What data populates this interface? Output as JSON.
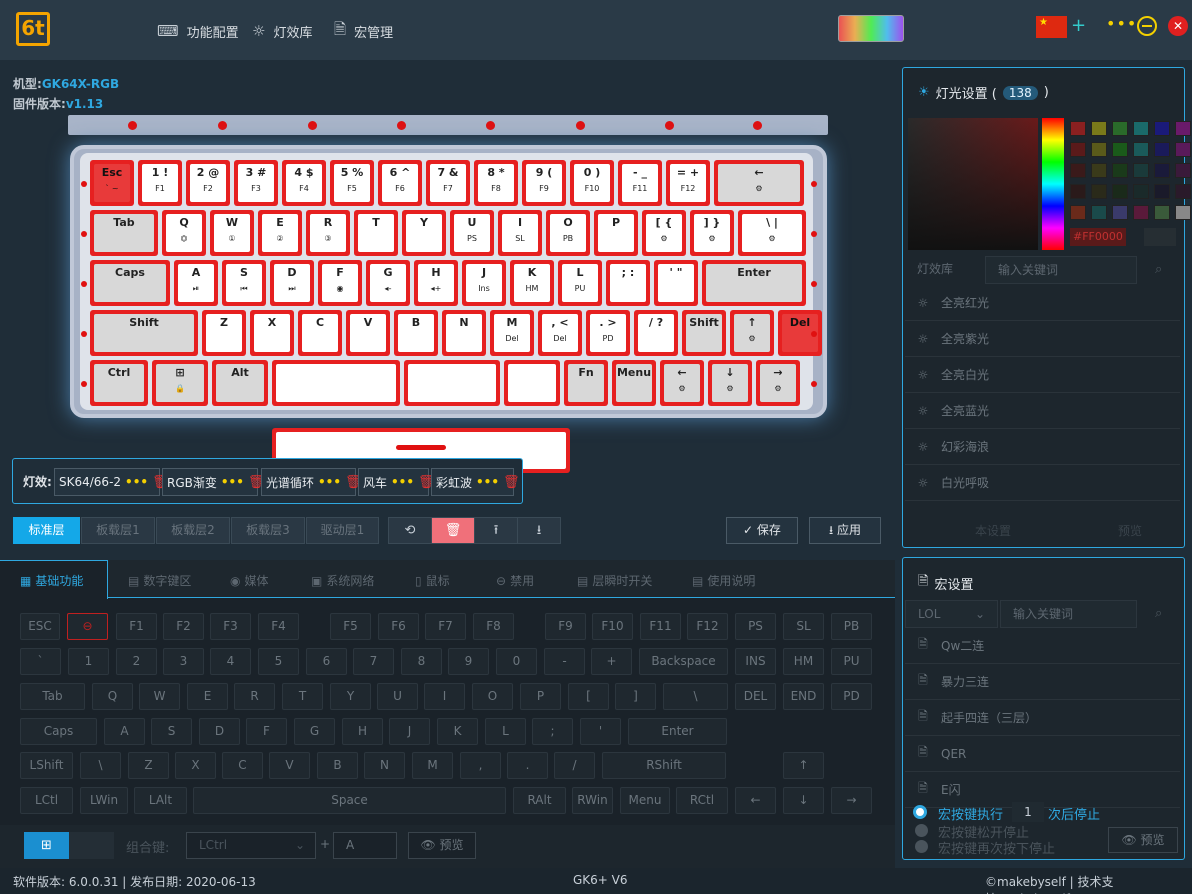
{
  "app": {
    "logo_text": "6t"
  },
  "nav": [
    {
      "label": "功能配置",
      "icon": "keyboard-icon"
    },
    {
      "label": "灯效库",
      "icon": "bulb-icon"
    },
    {
      "label": "宏管理",
      "icon": "document-icon"
    }
  ],
  "device": {
    "model_label": "机型:",
    "model": "GK64X-RGB",
    "firmware_label": "固件版本:",
    "firmware": "v1.13"
  },
  "keyboard": {
    "rows": [
      [
        {
          "t": "Esc",
          "s": "` ~",
          "style": "red"
        },
        {
          "t": "1 !",
          "s": "F1"
        },
        {
          "t": "2 @",
          "s": "F2"
        },
        {
          "t": "3 #",
          "s": "F3"
        },
        {
          "t": "4 $",
          "s": "F4"
        },
        {
          "t": "5 %",
          "s": "F5"
        },
        {
          "t": "6 ^",
          "s": "F6"
        },
        {
          "t": "7 &",
          "s": "F7"
        },
        {
          "t": "8 *",
          "s": "F8"
        },
        {
          "t": "9 (",
          "s": "F9"
        },
        {
          "t": "0 )",
          "s": "F10"
        },
        {
          "t": "- _",
          "s": "F11"
        },
        {
          "t": "= +",
          "s": "F12"
        },
        {
          "t": "←",
          "s": "⚙",
          "style": "gray"
        }
      ],
      [
        {
          "t": "Tab",
          "s": "",
          "style": "gray"
        },
        {
          "t": "Q",
          "s": "⏣"
        },
        {
          "t": "W",
          "s": "①"
        },
        {
          "t": "E",
          "s": "②"
        },
        {
          "t": "R",
          "s": "③"
        },
        {
          "t": "T",
          "s": ""
        },
        {
          "t": "Y",
          "s": ""
        },
        {
          "t": "U",
          "s": "PS"
        },
        {
          "t": "I",
          "s": "SL"
        },
        {
          "t": "O",
          "s": "PB"
        },
        {
          "t": "P",
          "s": ""
        },
        {
          "t": "[ {",
          "s": "⚙"
        },
        {
          "t": "] }",
          "s": "⚙"
        },
        {
          "t": "\\ |",
          "s": "⚙"
        }
      ],
      [
        {
          "t": "Caps",
          "s": "",
          "style": "gray"
        },
        {
          "t": "A",
          "s": "⏯"
        },
        {
          "t": "S",
          "s": "⏮"
        },
        {
          "t": "D",
          "s": "⏭"
        },
        {
          "t": "F",
          "s": "◉"
        },
        {
          "t": "G",
          "s": "◂-"
        },
        {
          "t": "H",
          "s": "◂+"
        },
        {
          "t": "J",
          "s": "Ins"
        },
        {
          "t": "K",
          "s": "HM"
        },
        {
          "t": "L",
          "s": "PU"
        },
        {
          "t": "; :",
          "s": ""
        },
        {
          "t": "' \"",
          "s": ""
        },
        {
          "t": "Enter",
          "s": "",
          "style": "gray"
        }
      ],
      [
        {
          "t": "Shift",
          "s": "",
          "style": "gray"
        },
        {
          "t": "Z",
          "s": ""
        },
        {
          "t": "X",
          "s": ""
        },
        {
          "t": "C",
          "s": ""
        },
        {
          "t": "V",
          "s": ""
        },
        {
          "t": "B",
          "s": ""
        },
        {
          "t": "N",
          "s": ""
        },
        {
          "t": "M",
          "s": "Del"
        },
        {
          "t": ", <",
          "s": "Del"
        },
        {
          "t": ". >",
          "s": "PD"
        },
        {
          "t": "/ ?",
          "s": ""
        },
        {
          "t": "Shift",
          "s": "",
          "style": "gray"
        },
        {
          "t": "↑",
          "s": "⚙",
          "style": "gray"
        },
        {
          "t": "Del",
          "s": "",
          "style": "red"
        }
      ],
      [
        {
          "t": "Ctrl",
          "s": "",
          "style": "gray"
        },
        {
          "t": "⊞",
          "s": "🔒",
          "style": "gray"
        },
        {
          "t": "Alt",
          "s": "",
          "style": "gray"
        },
        {
          "t": "",
          "s": ""
        },
        {
          "t": "",
          "s": ""
        },
        {
          "t": "",
          "s": ""
        },
        {
          "t": "Fn",
          "s": "",
          "style": "gray"
        },
        {
          "t": "Menu",
          "s": "",
          "style": "gray"
        },
        {
          "t": "←",
          "s": "⚙",
          "style": "gray"
        },
        {
          "t": "↓",
          "s": "⚙",
          "style": "gray"
        },
        {
          "t": "→",
          "s": "⚙",
          "style": "gray"
        }
      ]
    ]
  },
  "effects": {
    "label": "灯效:",
    "items": [
      "SK64/66-2",
      "RGB渐变",
      "光谱循环",
      "风车",
      "彩虹波"
    ]
  },
  "layers": [
    "标准层",
    "板载层1",
    "板载层2",
    "板载层3",
    "驱动层1"
  ],
  "tools": [
    "⟲",
    "🗑",
    "⭱",
    "⭳"
  ],
  "actions": {
    "save": "保存",
    "apply": "应用",
    "save_icon": "check-icon",
    "apply_icon": "download-icon"
  },
  "bottom_tabs": [
    {
      "label": "基础功能",
      "icon": "▦"
    },
    {
      "label": "数字键区",
      "icon": "▤"
    },
    {
      "label": "媒体",
      "icon": "◉"
    },
    {
      "label": "系统网络",
      "icon": "▣"
    },
    {
      "label": "鼠标",
      "icon": "▯"
    },
    {
      "label": "禁用",
      "icon": "⊖"
    },
    {
      "label": "层瞬时开关",
      "icon": "▤"
    },
    {
      "label": "使用说明",
      "icon": "▤"
    }
  ],
  "virtual_keys": [
    [
      "ESC",
      "⊖",
      "F1",
      "F2",
      "F3",
      "F4",
      "F5",
      "F6",
      "F7",
      "F8",
      "F9",
      "F10",
      "F11",
      "F12",
      "PS",
      "SL",
      "PB"
    ],
    [
      "`",
      "1",
      "2",
      "3",
      "4",
      "5",
      "6",
      "7",
      "8",
      "9",
      "0",
      "-",
      "+",
      "Backspace",
      "INS",
      "HM",
      "PU"
    ],
    [
      "Tab",
      "Q",
      "W",
      "E",
      "R",
      "T",
      "Y",
      "U",
      "I",
      "O",
      "P",
      "[",
      "]",
      "\\",
      "DEL",
      "END",
      "PD"
    ],
    [
      "Caps",
      "A",
      "S",
      "D",
      "F",
      "G",
      "H",
      "J",
      "K",
      "L",
      ";",
      "'",
      "Enter"
    ],
    [
      "LShift",
      "\\",
      "Z",
      "X",
      "C",
      "V",
      "B",
      "N",
      "M",
      ",",
      ".",
      "/",
      "RShift",
      "↑"
    ],
    [
      "LCtl",
      "LWin",
      "LAlt",
      "Space",
      "RAlt",
      "RWin",
      "Menu",
      "RCtl",
      "←",
      "↓",
      "→"
    ]
  ],
  "combo": {
    "label": "组合键:",
    "select": "LCtrl",
    "plus": "+",
    "key": "A",
    "preview": "预览"
  },
  "status": {
    "left": "软件版本: 6.0.0.31 | 发布日期: 2020-06-13",
    "center": "GK6+ V6",
    "right": "©makebyself | 技术支持:makebyself"
  },
  "light_panel": {
    "title": "灯光设置 (",
    "count": "138",
    "title_end": ")",
    "hex": "#FF0000",
    "library_label": "灯效库",
    "search_placeholder": "输入关键词",
    "items": [
      "全亮红光",
      "全亮紫光",
      "全亮白光",
      "全亮蓝光",
      "幻彩海浪",
      "白光呼吸"
    ],
    "bottom": [
      "本设置",
      "预览"
    ]
  },
  "macro_panel": {
    "title": "宏设置",
    "filter": "LOL",
    "search_placeholder": "输入关键词",
    "items": [
      "Qw二连",
      "暴力三连",
      "起手四连（三层）",
      "QER",
      "E闪"
    ],
    "opt1": "宏按键执行",
    "opt1_count": "1",
    "opt1_end": "次后停止",
    "opt2": "宏按键松开停止",
    "opt3": "宏按键再次按下停止",
    "preview": "预览"
  },
  "colors": {
    "accent": "#2fa8e0",
    "key_red": "#e62020",
    "active_layer": "#14a8e8"
  }
}
